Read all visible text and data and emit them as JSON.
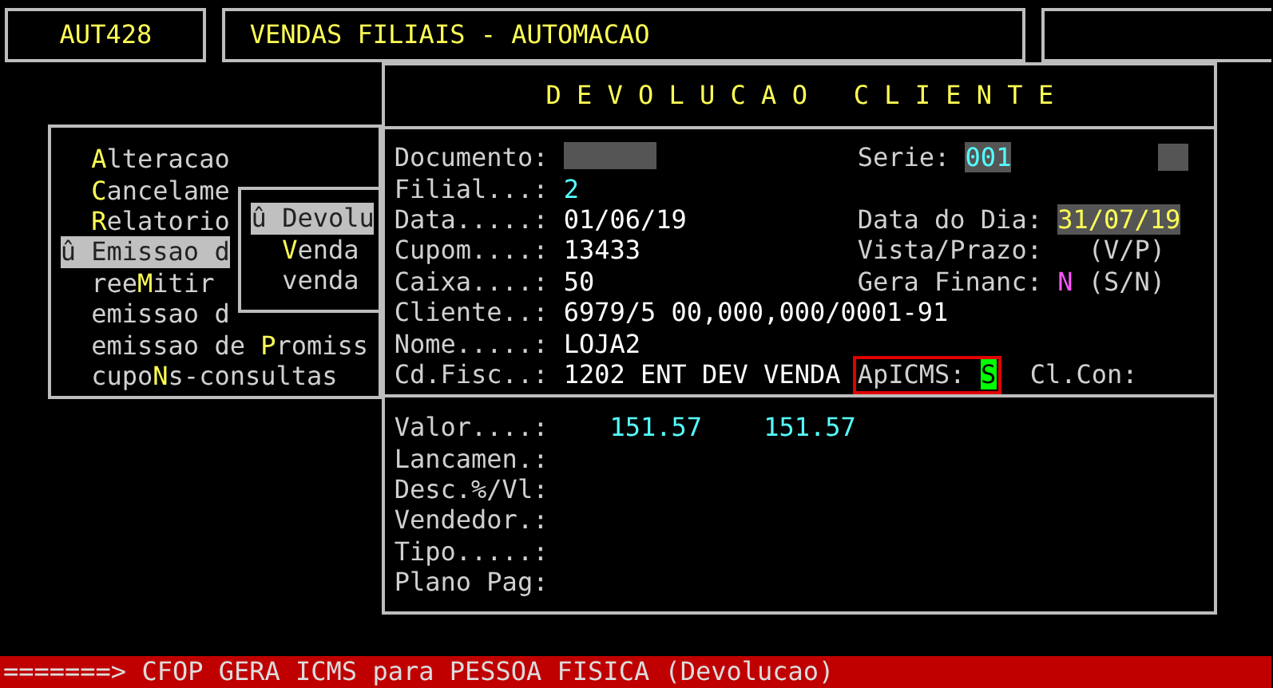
{
  "header": {
    "program_code": "AUT428",
    "title": "VENDAS FILIAIS - AUTOMACAO"
  },
  "menu": {
    "items": [
      {
        "hotkey": "A",
        "after": "lteracao",
        "selected": false
      },
      {
        "hotkey": "C",
        "after": "ancelame",
        "selected": false
      },
      {
        "hotkey": "R",
        "after": "elatorio",
        "selected": false
      },
      {
        "marker": "û",
        "before": "Emissao d",
        "selected": true
      },
      {
        "before": "ree",
        "hotkey": "M",
        "after": "itir",
        "selected": false
      },
      {
        "before": "emissao d",
        "selected": false
      },
      {
        "before": "emissao de ",
        "hotkey": "P",
        "after": "romiss",
        "selected": false
      },
      {
        "before": "cupo",
        "hotkey": "N",
        "after": "s-consultas",
        "selected": false
      }
    ]
  },
  "submenu": {
    "items": [
      {
        "marker": "û",
        "before": "Devolu",
        "selected": true
      },
      {
        "hotkey": "V",
        "after": "enda",
        "selected": false
      },
      {
        "before": "venda",
        "selected": false
      }
    ]
  },
  "dialog": {
    "title": "D E V O L U C A O   C L I E N T E",
    "rows": [
      {
        "left": {
          "label": "Documento:",
          "masked": true
        },
        "right": [
          {
            "label": "Serie:",
            "value": "001",
            "kind": "code"
          },
          {
            "masked": true
          }
        ]
      },
      {
        "left": {
          "label": "Filial...:",
          "value": "2",
          "color": "#55ffff"
        }
      },
      {
        "left": {
          "label": "Data.....:",
          "value": "01/06/19",
          "color": "#ffffff"
        },
        "right": [
          {
            "label": "Data do Dia:",
            "value": "31/07/19",
            "kind": "date"
          }
        ]
      },
      {
        "left": {
          "label": "Cupom....:",
          "value": "13433",
          "color": "#ffffff"
        },
        "right": [
          {
            "label": "Vista/Prazo:",
            "hint": "(V/P)"
          }
        ]
      },
      {
        "left": {
          "label": "Caixa....:",
          "value": "50",
          "color": "#ffffff"
        },
        "right": [
          {
            "label": "Gera Financ:",
            "value": "N",
            "color": "#ff55ff",
            "hint": "(S/N)"
          }
        ]
      },
      {
        "left": {
          "label": "Cliente..:",
          "value": "6979/5 00,000,000/0001-91",
          "color": "#ffffff"
        }
      },
      {
        "left": {
          "label": "Nome.....:",
          "value": "LOJA2",
          "color": "#ffffff"
        }
      },
      {
        "left": {
          "label": "Cd.Fisc..:",
          "value": "1202 ENT DEV VENDA",
          "color": "#ffffff"
        },
        "right": [
          {
            "label": "ApICMS:",
            "value": "S",
            "kind": "cursor",
            "flagged": true
          },
          {
            "label": "Cl.Con:"
          }
        ]
      }
    ],
    "totals": [
      {
        "label": "Valor....:",
        "values": [
          "151.57",
          "151.57"
        ]
      },
      {
        "label": "Lancamen.:"
      },
      {
        "label": "Desc.%/Vl:"
      },
      {
        "label": "Vendedor.:"
      },
      {
        "label": "Tipo.....:"
      },
      {
        "label": "Plano Pag:"
      }
    ]
  },
  "status_bar": "=======> CFOP GERA ICMS para PESSOA FISICA (Devolucao)"
}
